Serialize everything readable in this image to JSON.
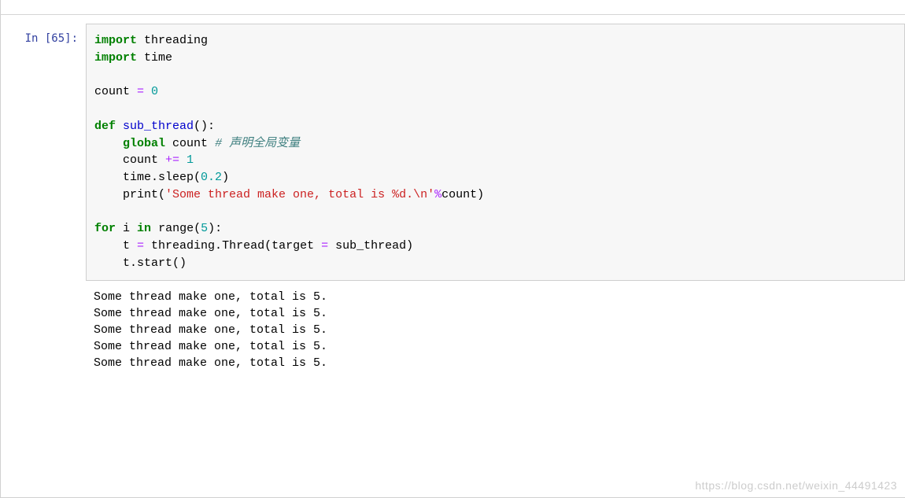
{
  "prompt": "In [65]:",
  "code": {
    "l0": {
      "kw1": "import",
      "sp": " ",
      "name": "threading"
    },
    "l1": {
      "kw1": "import",
      "sp": " ",
      "name": "time"
    },
    "l2": "",
    "l3": {
      "name": "count ",
      "op": "=",
      "num": " 0"
    },
    "l4": "",
    "l5": {
      "kw": "def",
      "sp": " ",
      "fn": "sub_thread",
      "rest": "():"
    },
    "l6": {
      "indent": "    ",
      "kw": "global",
      "sp": " ",
      "name": "count ",
      "cmt": "# 声明全局变量"
    },
    "l7": {
      "indent": "    ",
      "name1": "count ",
      "op": "+=",
      "num": " 1"
    },
    "l8": {
      "indent": "    ",
      "name": "time.sleep(",
      "num": "0.2",
      "rest": ")"
    },
    "l9": {
      "indent": "    ",
      "name": "print(",
      "str": "'Some thread make one, total is %d.\\n'",
      "op": "%",
      "name2": "count)"
    },
    "l10": "",
    "l11": {
      "kw": "for",
      "sp": " ",
      "name": "i ",
      "kw2": "in",
      "sp2": " ",
      "name2": "range(",
      "num": "5",
      "rest": "):"
    },
    "l12": {
      "indent": "    ",
      "name": "t ",
      "op": "=",
      "name2": " threading.Thread(target ",
      "op2": "=",
      "name3": " sub_thread)"
    },
    "l13": {
      "indent": "    ",
      "name": "t.start()"
    }
  },
  "output_lines": [
    "Some thread make one, total is 5.",
    "Some thread make one, total is 5.",
    "Some thread make one, total is 5.",
    "Some thread make one, total is 5.",
    "Some thread make one, total is 5."
  ],
  "watermark": "https://blog.csdn.net/weixin_44491423"
}
